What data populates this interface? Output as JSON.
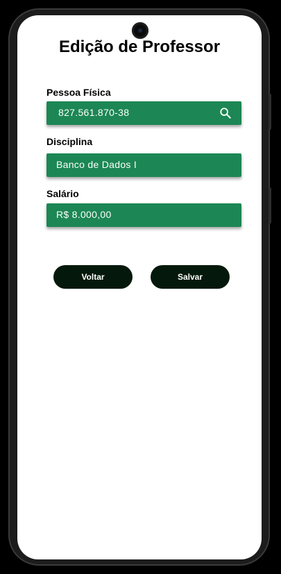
{
  "page": {
    "title": "Edição de Professor"
  },
  "form": {
    "pessoa_fisica": {
      "label": "Pessoa Física",
      "value": "827.561.870-38",
      "icon": "search-icon"
    },
    "disciplina": {
      "label": "Disciplina",
      "value": "Banco de Dados I"
    },
    "salario": {
      "label": "Salário",
      "value": "R$ 8.000,00"
    }
  },
  "actions": {
    "back_label": "Voltar",
    "save_label": "Salvar"
  },
  "colors": {
    "field_background": "#1c8754",
    "button_background": "#04190b",
    "text_on_dark": "#ffffff"
  }
}
